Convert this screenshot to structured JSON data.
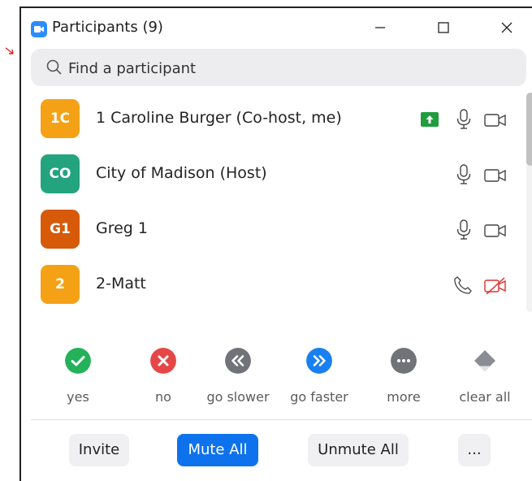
{
  "window": {
    "title": "Participants (9)",
    "controls": [
      "minimize",
      "maximize",
      "close"
    ]
  },
  "search": {
    "placeholder": "Find a participant",
    "value": ""
  },
  "participants": [
    {
      "initials": "1C",
      "name": "1 Caroline Burger (Co-host, me)",
      "avatar_color": "#f5a116",
      "status": "raised-hand",
      "audio": "microphone",
      "video": "camera"
    },
    {
      "initials": "CO",
      "name": "City of Madison (Host)",
      "avatar_color": "#23a37e",
      "audio": "microphone",
      "video": "camera"
    },
    {
      "initials": "G1",
      "name": "Greg 1",
      "avatar_color": "#d65a08",
      "audio": "microphone",
      "video": "camera"
    },
    {
      "initials": "2",
      "name": "2-Matt",
      "avatar_color": "#f5a116",
      "audio": "phone",
      "video": "camera-off"
    }
  ],
  "reactions": [
    {
      "label": "yes",
      "color": "#23b15a",
      "icon": "check-icon"
    },
    {
      "label": "no",
      "color": "#e54747",
      "icon": "x-icon"
    },
    {
      "label": "go slower",
      "color": "#707378",
      "icon": "rewind-icon"
    },
    {
      "label": "go faster",
      "color": "#1a7ff0",
      "icon": "fast-forward-icon"
    },
    {
      "label": "more",
      "color": "#707378",
      "icon": "more-icon"
    },
    {
      "label": "clear all",
      "color": "#707378",
      "icon": "eraser-icon"
    }
  ],
  "buttons": {
    "invite": "Invite",
    "mute_all": "Mute All",
    "unmute_all": "Unmute All",
    "more": "..."
  },
  "colors": {
    "accent": "#0e72ed",
    "search_bg": "#ededf0"
  }
}
